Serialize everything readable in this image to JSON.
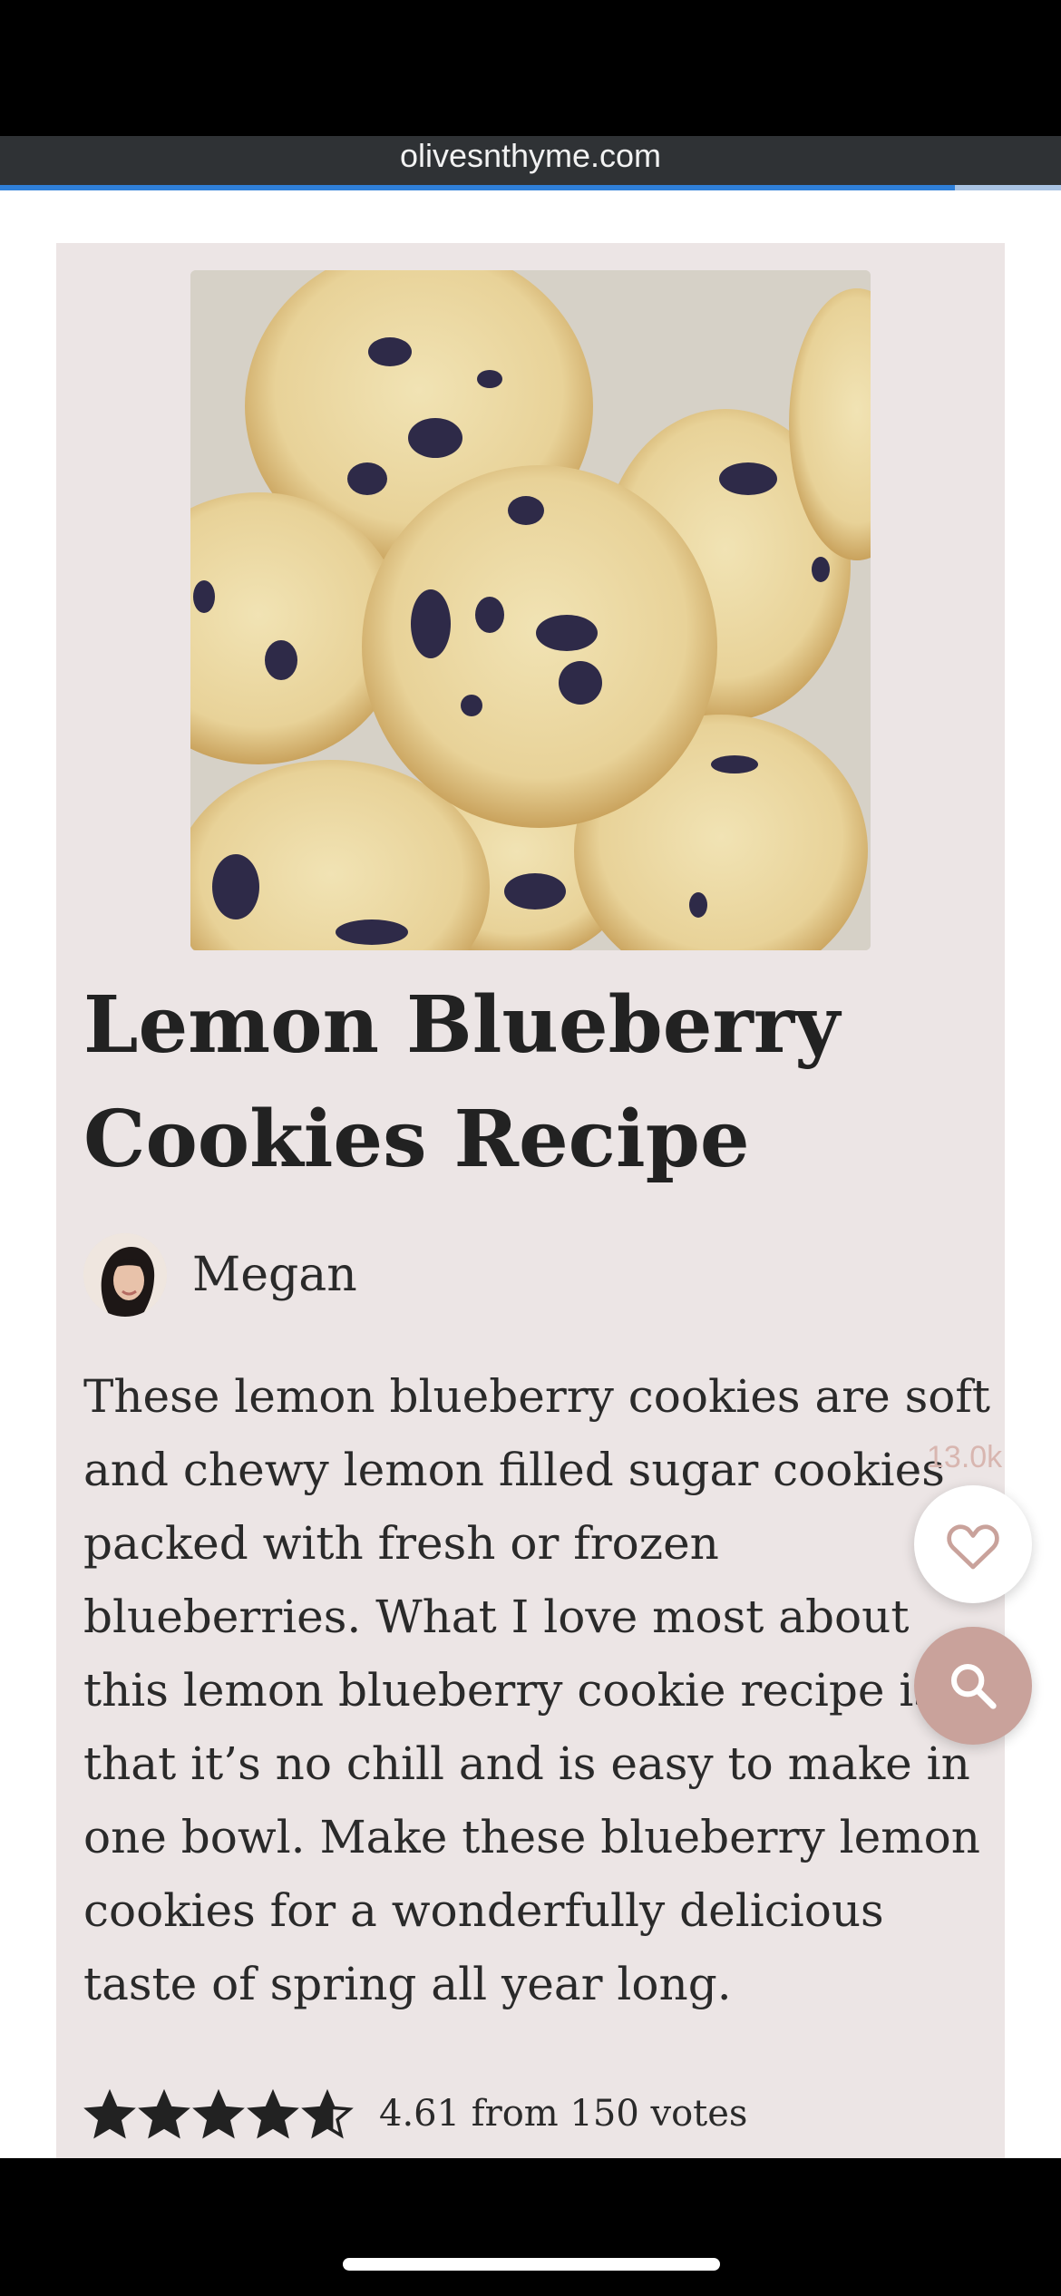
{
  "browser": {
    "url": "olivesnthyme.com",
    "load_progress": 0.9
  },
  "recipe": {
    "title": "Lemon Blueberry Cookies Recipe",
    "author": "Megan",
    "description": "These lemon blueberry cookies are soft and chewy lemon filled sugar cookies packed with fresh or frozen blueberries. What I love most about this lemon blueberry cookie recipe is that it’s no chill and is easy to make in one bowl. Make these blueberry lemon cookies for a wonderfully delicious taste of spring all year long.",
    "rating_value": 4.61,
    "rating_text": "4.61 from 150 votes"
  },
  "floating": {
    "favorite_count": "13.0k"
  },
  "icons": {
    "favorite": "heart-icon",
    "search": "search-icon",
    "star": "star-icon"
  },
  "colors": {
    "card_background": "#ece5e5",
    "search_button": "#c9a29b",
    "favorite_count": "#d8b6b0",
    "progress": "#2f7fd8"
  }
}
